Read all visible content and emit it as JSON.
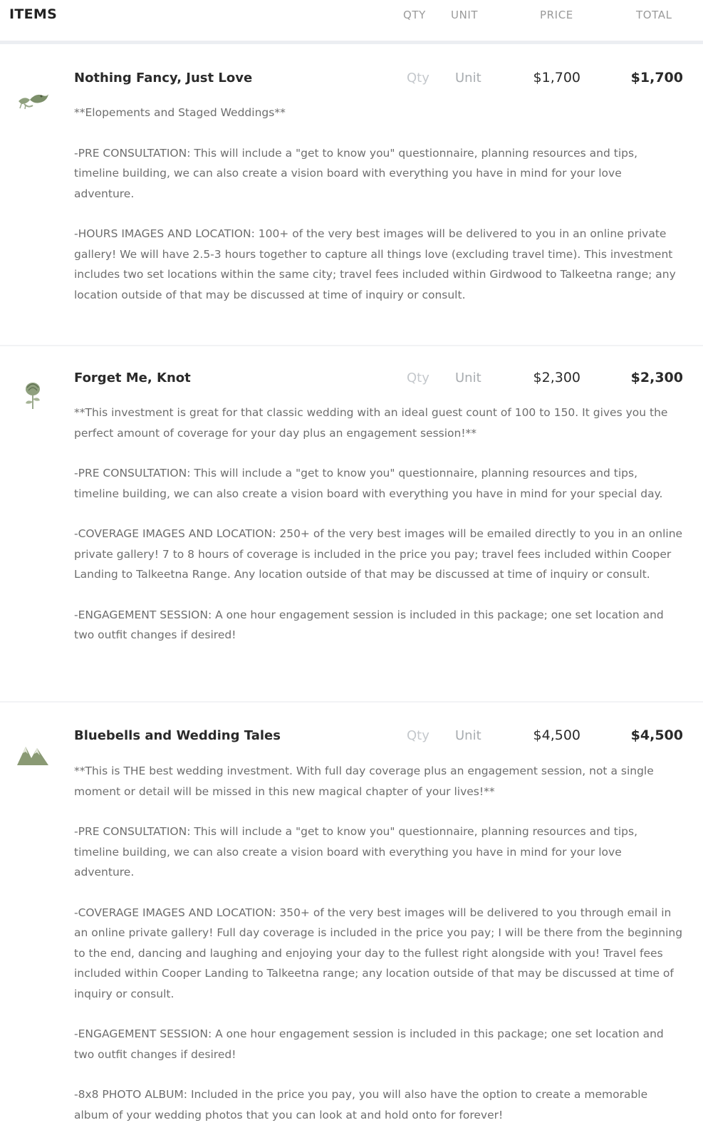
{
  "header": {
    "items_label": "ITEMS",
    "qty_label": "QTY",
    "unit_label": "UNIT",
    "price_label": "PRICE",
    "total_label": "TOTAL"
  },
  "items": [
    {
      "icon": "birds-icon",
      "name": "Nothing Fancy, Just Love",
      "qty_placeholder": "Qty",
      "unit_placeholder": "Unit",
      "price": "$1,700",
      "total": "$1,700",
      "paragraphs": [
        "**Elopements and Staged Weddings**",
        "-PRE CONSULTATION: This will include a \"get to know you\" questionnaire, planning resources and tips, timeline building, we can also create a vision board with everything you have in mind for your love adventure.",
        "-HOURS IMAGES AND LOCATION: 100+ of the very best images will be delivered to you in an online private gallery! We will have 2.5-3 hours together to capture all things love (excluding travel time). This investment includes two set locations within the same city; travel fees included within Girdwood to Talkeetna range; any location outside of that may be discussed at time of inquiry or consult."
      ]
    },
    {
      "icon": "flower-icon",
      "name": "Forget Me, Knot",
      "qty_placeholder": "Qty",
      "unit_placeholder": "Unit",
      "price": "$2,300",
      "total": "$2,300",
      "paragraphs": [
        "**This investment is great for that classic wedding with an ideal guest count of 100 to 150. It gives you the perfect amount of coverage for your day plus an engagement session!**",
        "-PRE CONSULTATION: This will include a \"get to know you\" questionnaire, planning resources and tips, timeline building, we can also create a vision board with everything you have in mind for your special day.",
        "-COVERAGE IMAGES AND LOCATION: 250+ of the very best images will be emailed directly to you in an online private gallery! 7 to 8 hours of coverage is included in the price you pay; travel fees included within Cooper Landing to Talkeetna Range. Any location outside of that may be discussed at time of inquiry or consult.",
        "-ENGAGEMENT SESSION: A one hour engagement session is included in this package; one set location and two outfit changes if desired!"
      ]
    },
    {
      "icon": "mountains-icon",
      "name": "Bluebells and Wedding Tales",
      "qty_placeholder": "Qty",
      "unit_placeholder": "Unit",
      "price": "$4,500",
      "total": "$4,500",
      "paragraphs": [
        "**This is THE best wedding investment. With full day coverage plus an engagement session, not a single moment or detail will be missed in this new magical chapter of your lives!**",
        "-PRE CONSULTATION: This will include a \"get to know you\" questionnaire, planning resources and tips, timeline building, we can also create a vision board with everything you have in mind for your love adventure.",
        "-COVERAGE IMAGES AND LOCATION: 350+ of the very best images will be delivered to you through email in an online private gallery! Full day coverage is included in the price you pay; I will be there from the beginning to the end, dancing and laughing and enjoying your day to the fullest right alongside with you! Travel fees included within Cooper Landing to Talkeetna range; any location outside of that may be discussed at time of inquiry or consult.",
        "-ENGAGEMENT SESSION: A one hour engagement session is included in this package; one set location and two outfit changes if desired!",
        "-8x8 PHOTO ALBUM: Included in the price you pay, you will also have the option to create a memorable album of your wedding photos that you can look at and hold onto for forever!"
      ]
    }
  ]
}
